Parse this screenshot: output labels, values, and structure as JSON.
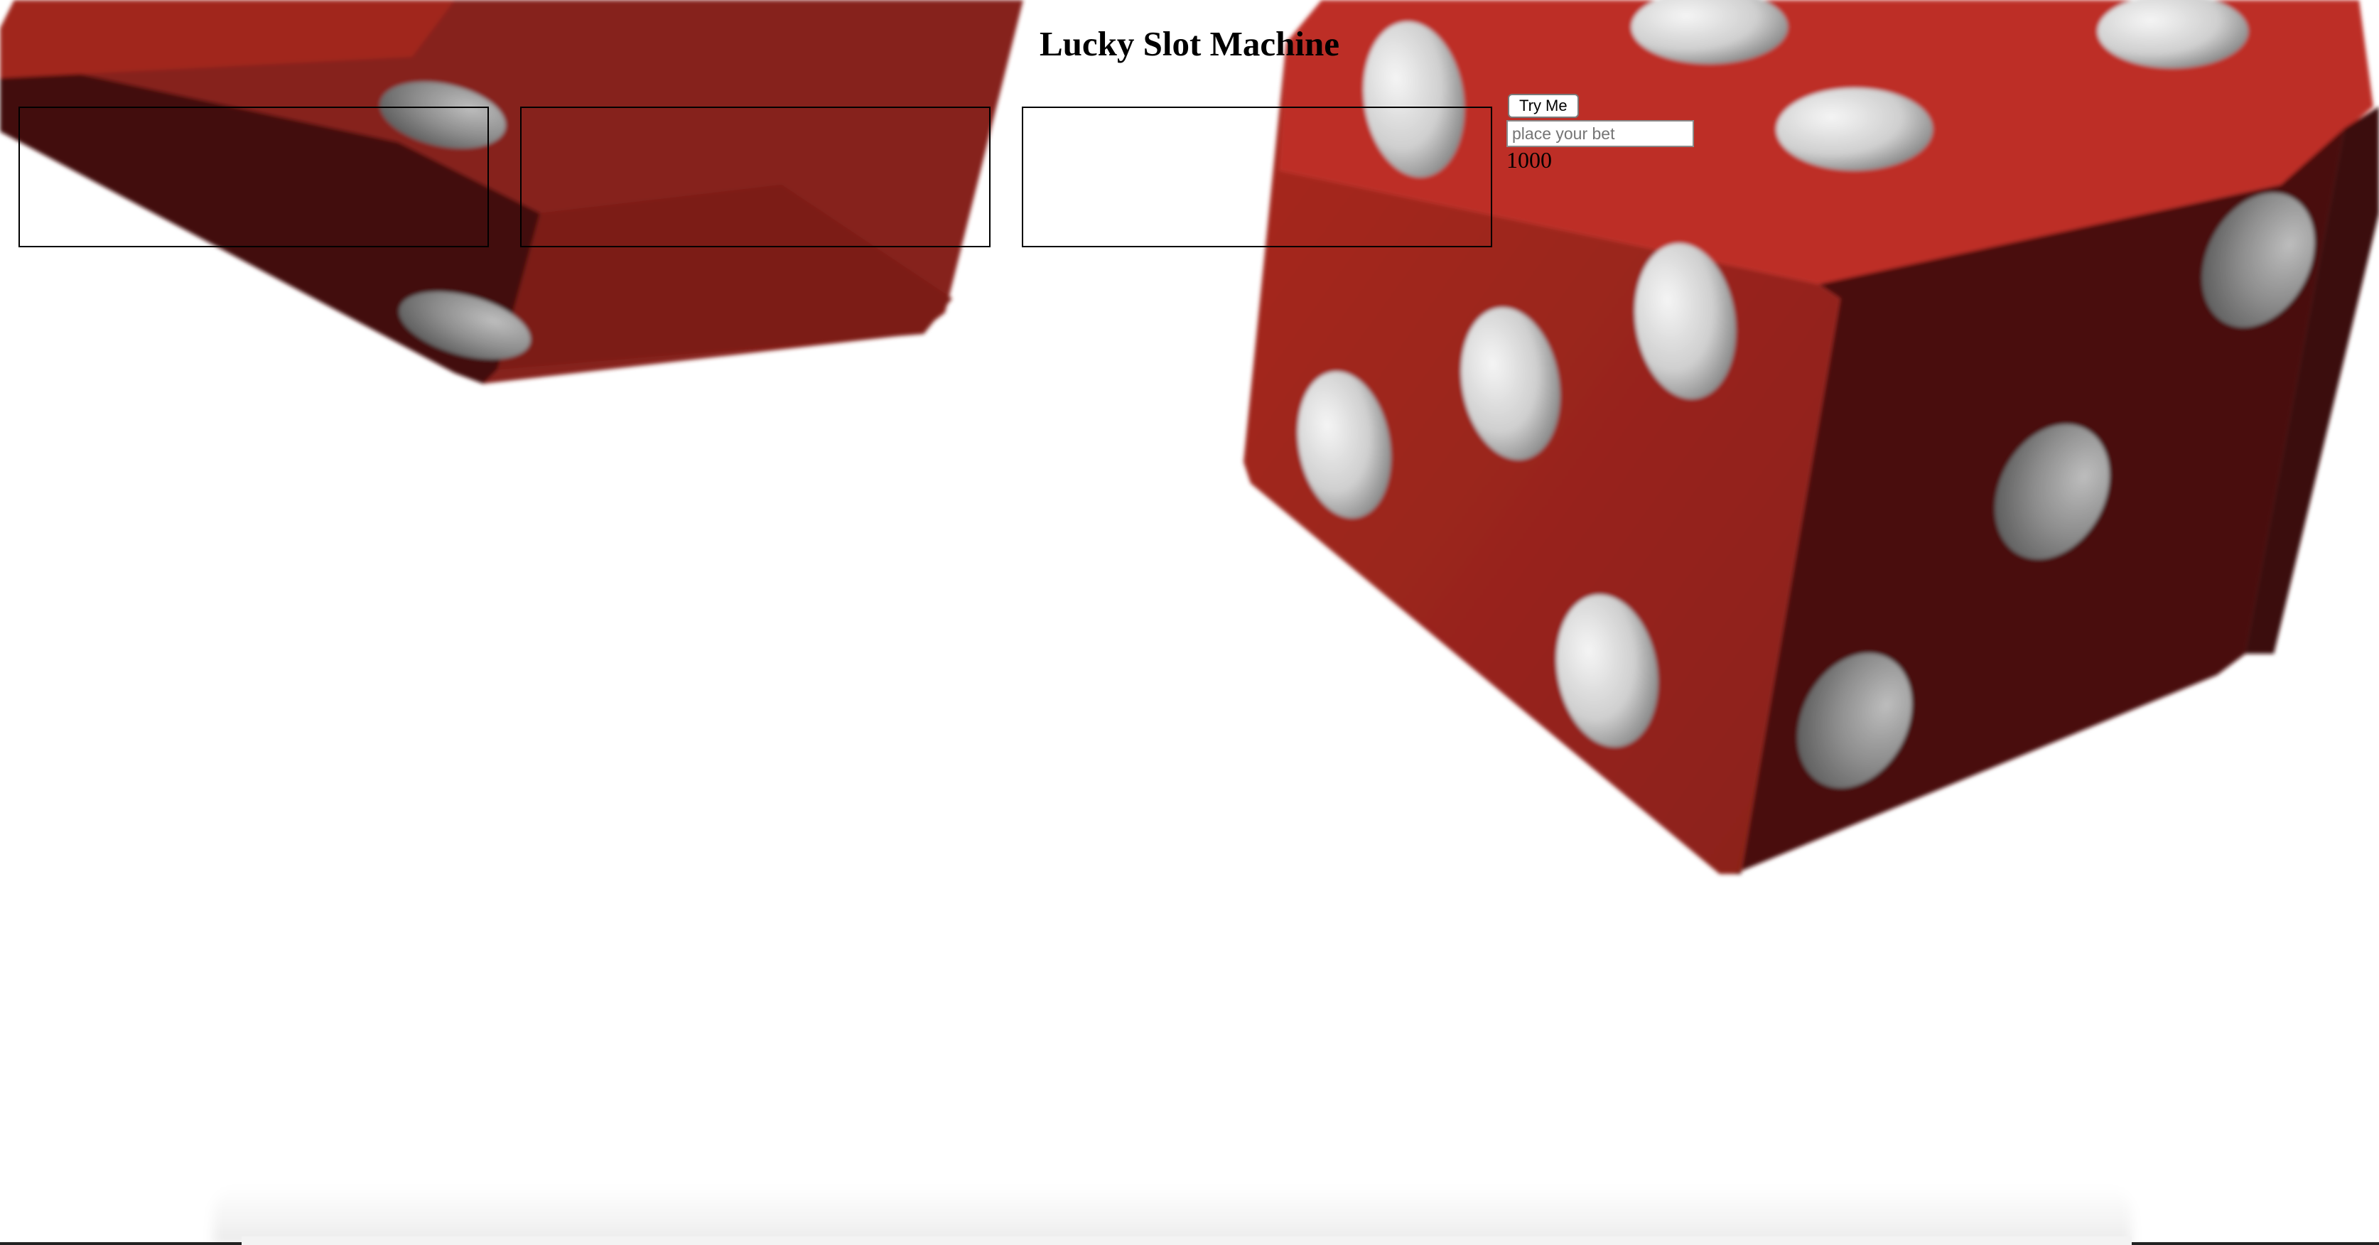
{
  "page": {
    "title": "Lucky Slot Machine"
  },
  "reels": [
    {
      "value": ""
    },
    {
      "value": ""
    },
    {
      "value": ""
    }
  ],
  "controls": {
    "spin_button_label": "Try Me",
    "bet_input_placeholder": "place your bet",
    "bet_input_value": "",
    "balance": "1000"
  },
  "background": {
    "image": "two red dice",
    "dice_color": "#b8281f",
    "pip_color": "#e8e8e8"
  }
}
